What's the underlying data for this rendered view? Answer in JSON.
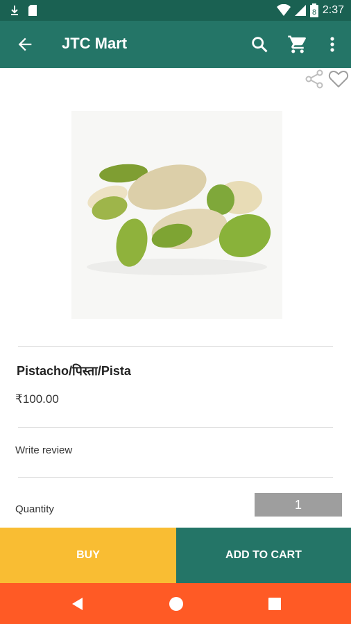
{
  "status_bar": {
    "time": "2:37",
    "battery": "8"
  },
  "app_bar": {
    "title": "JTC Mart"
  },
  "product": {
    "name": "Pistacho/पिस्ता/Pista",
    "price": "₹100.00"
  },
  "review": {
    "label": "Write review"
  },
  "quantity": {
    "label": "Quantity",
    "value": "1"
  },
  "actions": {
    "buy": "BUY",
    "add_to_cart": "ADD TO CART"
  },
  "colors": {
    "primary": "#247567",
    "status_bar": "#1a6152",
    "buy": "#f9bd33",
    "nav_bar": "#ff5a25",
    "quantity_box": "#9e9e9e"
  },
  "icons": [
    "download-icon",
    "sd-card-icon",
    "wifi-icon",
    "signal-icon",
    "battery-icon",
    "back-arrow-icon",
    "search-icon",
    "cart-icon",
    "more-vert-icon",
    "share-icon",
    "heart-icon",
    "nav-back-icon",
    "nav-home-icon",
    "nav-recent-icon"
  ]
}
